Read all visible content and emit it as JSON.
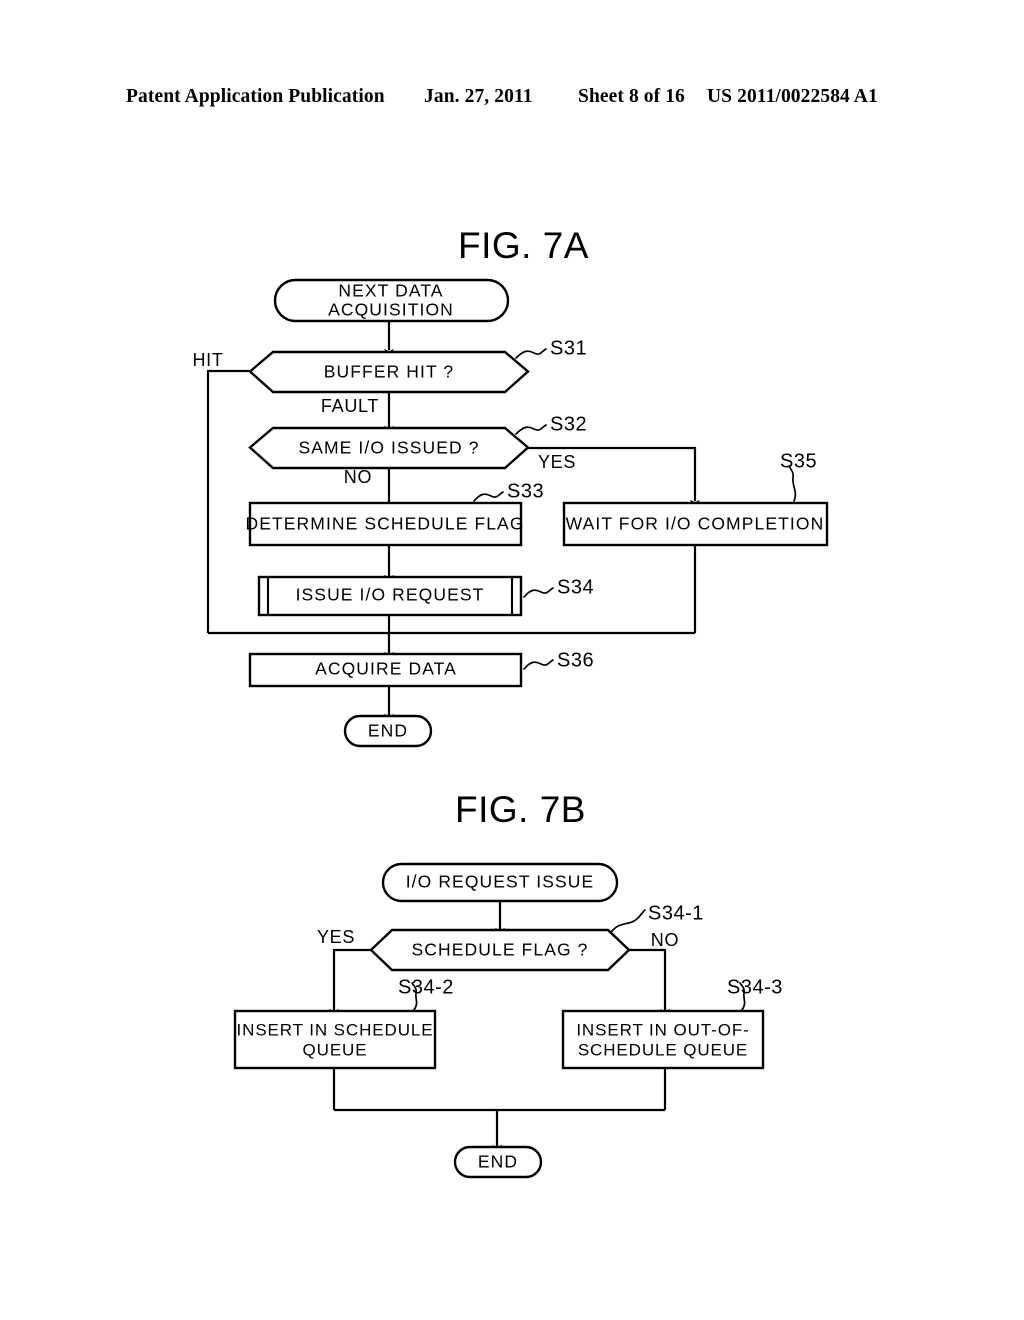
{
  "header": {
    "publication": "Patent Application Publication",
    "date": "Jan. 27, 2011",
    "sheet": "Sheet 8 of 16",
    "number": "US 2011/0022584 A1"
  },
  "figures": [
    {
      "id": "fig-7a",
      "title": "FIG. 7A",
      "nodes": {
        "start": "NEXT DATA\nACQUISITION",
        "start_line1": "NEXT  DATA",
        "start_line2": "ACQUISITION",
        "buffer_hit": "BUFFER  HIT  ?",
        "same_io": "SAME  I/O  ISSUED  ?",
        "determine_flag": "DETERMINE  SCHEDULE  FLAG",
        "wait_io": "WAIT  FOR  I/O COMPLETION",
        "issue_io": "ISSUE  I/O  REQUEST",
        "acquire": "ACQUIRE  DATA",
        "end": "END"
      },
      "edge_labels": {
        "hit": "HIT",
        "fault": "FAULT",
        "no": "NO",
        "yes": "YES"
      },
      "refs": {
        "s31": "S31",
        "s32": "S32",
        "s33": "S33",
        "s34": "S34",
        "s35": "S35",
        "s36": "S36"
      }
    },
    {
      "id": "fig-7b",
      "title": "FIG. 7B",
      "nodes": {
        "start": "I/O  REQUEST  ISSUE",
        "schedule_flag": "SCHEDULE  FLAG  ?",
        "insert_schedule_line1": "INSERT  IN  SCHEDULE",
        "insert_schedule_line2": "QUEUE",
        "insert_out_line1": "INSERT  IN  OUT-OF-",
        "insert_out_line2": "SCHEDULE  QUEUE",
        "end": "END"
      },
      "edge_labels": {
        "yes": "YES",
        "no": "NO"
      },
      "refs": {
        "s34_1": "S34-1",
        "s34_2": "S34-2",
        "s34_3": "S34-3"
      }
    }
  ],
  "colors": {
    "ink": "#000000",
    "paper": "#ffffff"
  }
}
